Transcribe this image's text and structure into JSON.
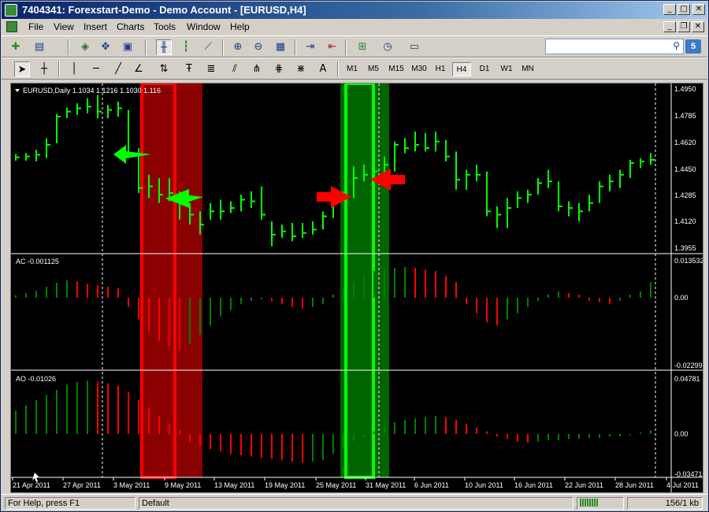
{
  "window": {
    "title": "7404341: Forexstart-Demo - Demo Account - [EURUSD,H4]",
    "minimize_glyph": "_",
    "maximize_glyph": "□",
    "close_glyph": "✕",
    "child_minimize_glyph": "_",
    "child_restore_glyph": "❐",
    "child_close_glyph": "✕"
  },
  "menu": {
    "items": [
      "File",
      "View",
      "Insert",
      "Charts",
      "Tools",
      "Window",
      "Help"
    ]
  },
  "toolbar": {
    "search_value": "",
    "search_icon": "search-icon",
    "messages_badge": "5",
    "text_tool_label": "A",
    "timeframes": [
      "M1",
      "M5",
      "M15",
      "M30",
      "H1",
      "H4",
      "D1",
      "W1",
      "MN"
    ],
    "active_timeframe": "H4"
  },
  "chart": {
    "symbol_label": "EURUSD,Daily  1.1034 1.1216 1.1030 1.116",
    "ac_label": "AC -0.001125",
    "ao_label": "AO -0.01026",
    "price_ticks": [
      "1.4950",
      "1.4785",
      "1.4620",
      "1.4450",
      "1.4285",
      "1.4120",
      "1.3955"
    ],
    "ac_ticks": [
      "0.013532",
      "0.00",
      "-0.02299"
    ],
    "ao_ticks": [
      "0.04781",
      "0.00",
      "-0.03471"
    ],
    "date_labels": [
      "21 Apr 2011",
      "27 Apr 2011",
      "3 May 2011",
      "9 May 2011",
      "13 May 2011",
      "19 May 2011",
      "25 May 2011",
      "31 May 2011",
      "6 Jun 2011",
      "10 Jun 2011",
      "16 Jun 2011",
      "22 Jun 2011",
      "28 Jun 2011",
      "4 Jul 2011"
    ],
    "colors": {
      "background": "#000000",
      "bar_green": "#00ff00",
      "ind_green": "#008000",
      "ind_red": "#ff0000",
      "red_zone": "#8b0000",
      "red_outline": "#ff0000",
      "green_zone": "#006400",
      "green_outline": "#00ff00",
      "grid": "#ffffff",
      "text": "#ffffff"
    }
  },
  "chart_data": {
    "type": "bar",
    "title": "EURUSD,Daily  1.1034 1.1216 1.1030 1.116",
    "ylim": [
      1.3955,
      1.495
    ],
    "ohlc": [
      {
        "h": 1.4545,
        "l": 1.4505,
        "c": 1.4525
      },
      {
        "h": 1.455,
        "l": 1.4505,
        "c": 1.453
      },
      {
        "h": 1.457,
        "l": 1.45,
        "c": 1.454
      },
      {
        "h": 1.464,
        "l": 1.452,
        "c": 1.46
      },
      {
        "h": 1.4785,
        "l": 1.461,
        "c": 1.477
      },
      {
        "h": 1.4825,
        "l": 1.476,
        "c": 1.48
      },
      {
        "h": 1.485,
        "l": 1.478,
        "c": 1.482
      },
      {
        "h": 1.488,
        "l": 1.479,
        "c": 1.483
      },
      {
        "h": 1.49,
        "l": 1.476,
        "c": 1.48
      },
      {
        "h": 1.484,
        "l": 1.476,
        "c": 1.481
      },
      {
        "h": 1.486,
        "l": 1.477,
        "c": 1.482
      },
      {
        "h": 1.481,
        "l": 1.453,
        "c": 1.455
      },
      {
        "h": 1.458,
        "l": 1.431,
        "c": 1.434
      },
      {
        "h": 1.442,
        "l": 1.428,
        "c": 1.435
      },
      {
        "h": 1.44,
        "l": 1.425,
        "c": 1.43
      },
      {
        "h": 1.44,
        "l": 1.426,
        "c": 1.431
      },
      {
        "h": 1.432,
        "l": 1.415,
        "c": 1.426
      },
      {
        "h": 1.425,
        "l": 1.412,
        "c": 1.418
      },
      {
        "h": 1.42,
        "l": 1.406,
        "c": 1.412
      },
      {
        "h": 1.425,
        "l": 1.415,
        "c": 1.42
      },
      {
        "h": 1.427,
        "l": 1.415,
        "c": 1.42
      },
      {
        "h": 1.426,
        "l": 1.419,
        "c": 1.422
      },
      {
        "h": 1.43,
        "l": 1.42,
        "c": 1.427
      },
      {
        "h": 1.432,
        "l": 1.422,
        "c": 1.426
      },
      {
        "h": 1.435,
        "l": 1.415,
        "c": 1.418
      },
      {
        "h": 1.414,
        "l": 1.399,
        "c": 1.406
      },
      {
        "h": 1.412,
        "l": 1.404,
        "c": 1.408
      },
      {
        "h": 1.413,
        "l": 1.402,
        "c": 1.405
      },
      {
        "h": 1.413,
        "l": 1.404,
        "c": 1.407
      },
      {
        "h": 1.414,
        "l": 1.406,
        "c": 1.409
      },
      {
        "h": 1.42,
        "l": 1.409,
        "c": 1.417
      },
      {
        "h": 1.429,
        "l": 1.416,
        "c": 1.427
      },
      {
        "h": 1.432,
        "l": 1.426,
        "c": 1.43
      },
      {
        "h": 1.447,
        "l": 1.428,
        "c": 1.44
      },
      {
        "h": 1.448,
        "l": 1.438,
        "c": 1.442
      },
      {
        "h": 1.447,
        "l": 1.439,
        "c": 1.444
      },
      {
        "h": 1.453,
        "l": 1.442,
        "c": 1.448
      },
      {
        "h": 1.462,
        "l": 1.444,
        "c": 1.46
      },
      {
        "h": 1.464,
        "l": 1.455,
        "c": 1.458
      },
      {
        "h": 1.468,
        "l": 1.456,
        "c": 1.46
      },
      {
        "h": 1.467,
        "l": 1.456,
        "c": 1.458
      },
      {
        "h": 1.468,
        "l": 1.456,
        "c": 1.462
      },
      {
        "h": 1.463,
        "l": 1.45,
        "c": 1.453
      },
      {
        "h": 1.456,
        "l": 1.433,
        "c": 1.439
      },
      {
        "h": 1.445,
        "l": 1.433,
        "c": 1.442
      },
      {
        "h": 1.448,
        "l": 1.438,
        "c": 1.442
      },
      {
        "h": 1.444,
        "l": 1.417,
        "c": 1.42
      },
      {
        "h": 1.423,
        "l": 1.41,
        "c": 1.418
      },
      {
        "h": 1.428,
        "l": 1.41,
        "c": 1.422
      },
      {
        "h": 1.432,
        "l": 1.422,
        "c": 1.428
      },
      {
        "h": 1.433,
        "l": 1.425,
        "c": 1.43
      },
      {
        "h": 1.44,
        "l": 1.43,
        "c": 1.437
      },
      {
        "h": 1.445,
        "l": 1.434,
        "c": 1.438
      },
      {
        "h": 1.438,
        "l": 1.42,
        "c": 1.423
      },
      {
        "h": 1.426,
        "l": 1.417,
        "c": 1.422
      },
      {
        "h": 1.425,
        "l": 1.414,
        "c": 1.42
      },
      {
        "h": 1.43,
        "l": 1.42,
        "c": 1.425
      },
      {
        "h": 1.438,
        "l": 1.425,
        "c": 1.435
      },
      {
        "h": 1.442,
        "l": 1.432,
        "c": 1.438
      },
      {
        "h": 1.445,
        "l": 1.434,
        "c": 1.442
      },
      {
        "h": 1.451,
        "l": 1.44,
        "c": 1.449
      },
      {
        "h": 1.452,
        "l": 1.446,
        "c": 1.45
      },
      {
        "h": 1.455,
        "l": 1.448,
        "c": 1.451
      }
    ],
    "ac_values": [
      0.0008,
      0.0015,
      0.0022,
      0.0035,
      0.0048,
      0.0055,
      0.0052,
      0.0045,
      0.004,
      0.0035,
      0.003,
      -0.003,
      -0.007,
      -0.011,
      -0.014,
      -0.016,
      -0.017,
      -0.015,
      -0.012,
      -0.009,
      -0.006,
      -0.004,
      -0.002,
      -0.001,
      -0.0005,
      -0.0012,
      -0.002,
      -0.003,
      -0.0035,
      -0.003,
      -0.002,
      0.001,
      0.003,
      0.005,
      0.007,
      0.0085,
      0.009,
      0.0095,
      0.0098,
      0.0095,
      0.009,
      0.0085,
      0.007,
      0.005,
      -0.002,
      -0.005,
      -0.008,
      -0.009,
      -0.007,
      -0.005,
      -0.003,
      -0.001,
      0.001,
      0.002,
      0.0015,
      0.001,
      -0.001,
      -0.0015,
      -0.002,
      -0.001,
      0.001,
      0.002,
      0.005
    ],
    "ao_values": [
      0.018,
      0.022,
      0.026,
      0.03,
      0.034,
      0.038,
      0.04,
      0.041,
      0.04,
      0.039,
      0.037,
      0.032,
      0.026,
      0.02,
      0.014,
      0.008,
      0.003,
      -0.006,
      -0.01,
      -0.012,
      -0.014,
      -0.016,
      -0.017,
      -0.018,
      -0.019,
      -0.02,
      -0.021,
      -0.022,
      -0.023,
      -0.022,
      -0.021,
      -0.016,
      -0.011,
      -0.006,
      -0.002,
      0.002,
      0.006,
      0.009,
      0.011,
      0.012,
      0.013,
      0.014,
      0.013,
      0.011,
      0.008,
      0.005,
      0.002,
      -0.002,
      -0.004,
      -0.006,
      -0.007,
      -0.006,
      -0.005,
      -0.005,
      -0.004,
      -0.004,
      -0.003,
      -0.003,
      -0.002,
      -0.002,
      -0.001,
      0.001,
      0.003
    ]
  },
  "status": {
    "help_text": "For Help, press F1",
    "profile": "Default",
    "traffic": "156/1 kb"
  }
}
